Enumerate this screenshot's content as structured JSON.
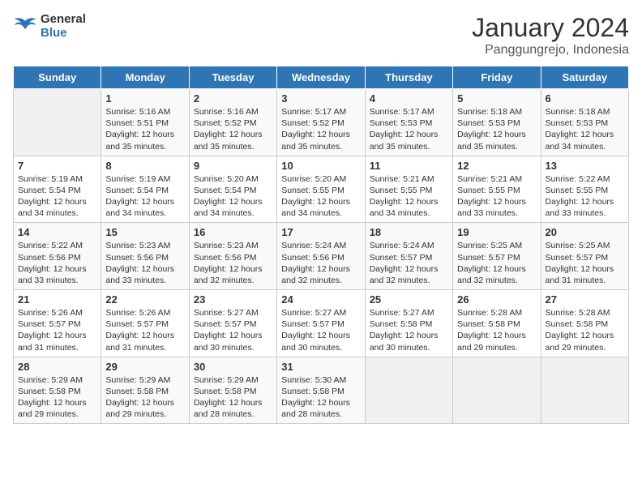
{
  "header": {
    "logo_line1": "General",
    "logo_line2": "Blue",
    "title": "January 2024",
    "subtitle": "Panggungrejo, Indonesia"
  },
  "days_of_week": [
    "Sunday",
    "Monday",
    "Tuesday",
    "Wednesday",
    "Thursday",
    "Friday",
    "Saturday"
  ],
  "weeks": [
    [
      {
        "num": "",
        "sunrise": "",
        "sunset": "",
        "daylight": ""
      },
      {
        "num": "1",
        "sunrise": "5:16 AM",
        "sunset": "5:51 PM",
        "daylight": "12 hours and 35 minutes."
      },
      {
        "num": "2",
        "sunrise": "5:16 AM",
        "sunset": "5:52 PM",
        "daylight": "12 hours and 35 minutes."
      },
      {
        "num": "3",
        "sunrise": "5:17 AM",
        "sunset": "5:52 PM",
        "daylight": "12 hours and 35 minutes."
      },
      {
        "num": "4",
        "sunrise": "5:17 AM",
        "sunset": "5:53 PM",
        "daylight": "12 hours and 35 minutes."
      },
      {
        "num": "5",
        "sunrise": "5:18 AM",
        "sunset": "5:53 PM",
        "daylight": "12 hours and 35 minutes."
      },
      {
        "num": "6",
        "sunrise": "5:18 AM",
        "sunset": "5:53 PM",
        "daylight": "12 hours and 34 minutes."
      }
    ],
    [
      {
        "num": "7",
        "sunrise": "5:19 AM",
        "sunset": "5:54 PM",
        "daylight": "12 hours and 34 minutes."
      },
      {
        "num": "8",
        "sunrise": "5:19 AM",
        "sunset": "5:54 PM",
        "daylight": "12 hours and 34 minutes."
      },
      {
        "num": "9",
        "sunrise": "5:20 AM",
        "sunset": "5:54 PM",
        "daylight": "12 hours and 34 minutes."
      },
      {
        "num": "10",
        "sunrise": "5:20 AM",
        "sunset": "5:55 PM",
        "daylight": "12 hours and 34 minutes."
      },
      {
        "num": "11",
        "sunrise": "5:21 AM",
        "sunset": "5:55 PM",
        "daylight": "12 hours and 34 minutes."
      },
      {
        "num": "12",
        "sunrise": "5:21 AM",
        "sunset": "5:55 PM",
        "daylight": "12 hours and 33 minutes."
      },
      {
        "num": "13",
        "sunrise": "5:22 AM",
        "sunset": "5:55 PM",
        "daylight": "12 hours and 33 minutes."
      }
    ],
    [
      {
        "num": "14",
        "sunrise": "5:22 AM",
        "sunset": "5:56 PM",
        "daylight": "12 hours and 33 minutes."
      },
      {
        "num": "15",
        "sunrise": "5:23 AM",
        "sunset": "5:56 PM",
        "daylight": "12 hours and 33 minutes."
      },
      {
        "num": "16",
        "sunrise": "5:23 AM",
        "sunset": "5:56 PM",
        "daylight": "12 hours and 32 minutes."
      },
      {
        "num": "17",
        "sunrise": "5:24 AM",
        "sunset": "5:56 PM",
        "daylight": "12 hours and 32 minutes."
      },
      {
        "num": "18",
        "sunrise": "5:24 AM",
        "sunset": "5:57 PM",
        "daylight": "12 hours and 32 minutes."
      },
      {
        "num": "19",
        "sunrise": "5:25 AM",
        "sunset": "5:57 PM",
        "daylight": "12 hours and 32 minutes."
      },
      {
        "num": "20",
        "sunrise": "5:25 AM",
        "sunset": "5:57 PM",
        "daylight": "12 hours and 31 minutes."
      }
    ],
    [
      {
        "num": "21",
        "sunrise": "5:26 AM",
        "sunset": "5:57 PM",
        "daylight": "12 hours and 31 minutes."
      },
      {
        "num": "22",
        "sunrise": "5:26 AM",
        "sunset": "5:57 PM",
        "daylight": "12 hours and 31 minutes."
      },
      {
        "num": "23",
        "sunrise": "5:27 AM",
        "sunset": "5:57 PM",
        "daylight": "12 hours and 30 minutes."
      },
      {
        "num": "24",
        "sunrise": "5:27 AM",
        "sunset": "5:57 PM",
        "daylight": "12 hours and 30 minutes."
      },
      {
        "num": "25",
        "sunrise": "5:27 AM",
        "sunset": "5:58 PM",
        "daylight": "12 hours and 30 minutes."
      },
      {
        "num": "26",
        "sunrise": "5:28 AM",
        "sunset": "5:58 PM",
        "daylight": "12 hours and 29 minutes."
      },
      {
        "num": "27",
        "sunrise": "5:28 AM",
        "sunset": "5:58 PM",
        "daylight": "12 hours and 29 minutes."
      }
    ],
    [
      {
        "num": "28",
        "sunrise": "5:29 AM",
        "sunset": "5:58 PM",
        "daylight": "12 hours and 29 minutes."
      },
      {
        "num": "29",
        "sunrise": "5:29 AM",
        "sunset": "5:58 PM",
        "daylight": "12 hours and 29 minutes."
      },
      {
        "num": "30",
        "sunrise": "5:29 AM",
        "sunset": "5:58 PM",
        "daylight": "12 hours and 28 minutes."
      },
      {
        "num": "31",
        "sunrise": "5:30 AM",
        "sunset": "5:58 PM",
        "daylight": "12 hours and 28 minutes."
      },
      {
        "num": "",
        "sunrise": "",
        "sunset": "",
        "daylight": ""
      },
      {
        "num": "",
        "sunrise": "",
        "sunset": "",
        "daylight": ""
      },
      {
        "num": "",
        "sunrise": "",
        "sunset": "",
        "daylight": ""
      }
    ]
  ],
  "labels": {
    "sunrise_prefix": "Sunrise: ",
    "sunset_prefix": "Sunset: ",
    "daylight_prefix": "Daylight: "
  }
}
